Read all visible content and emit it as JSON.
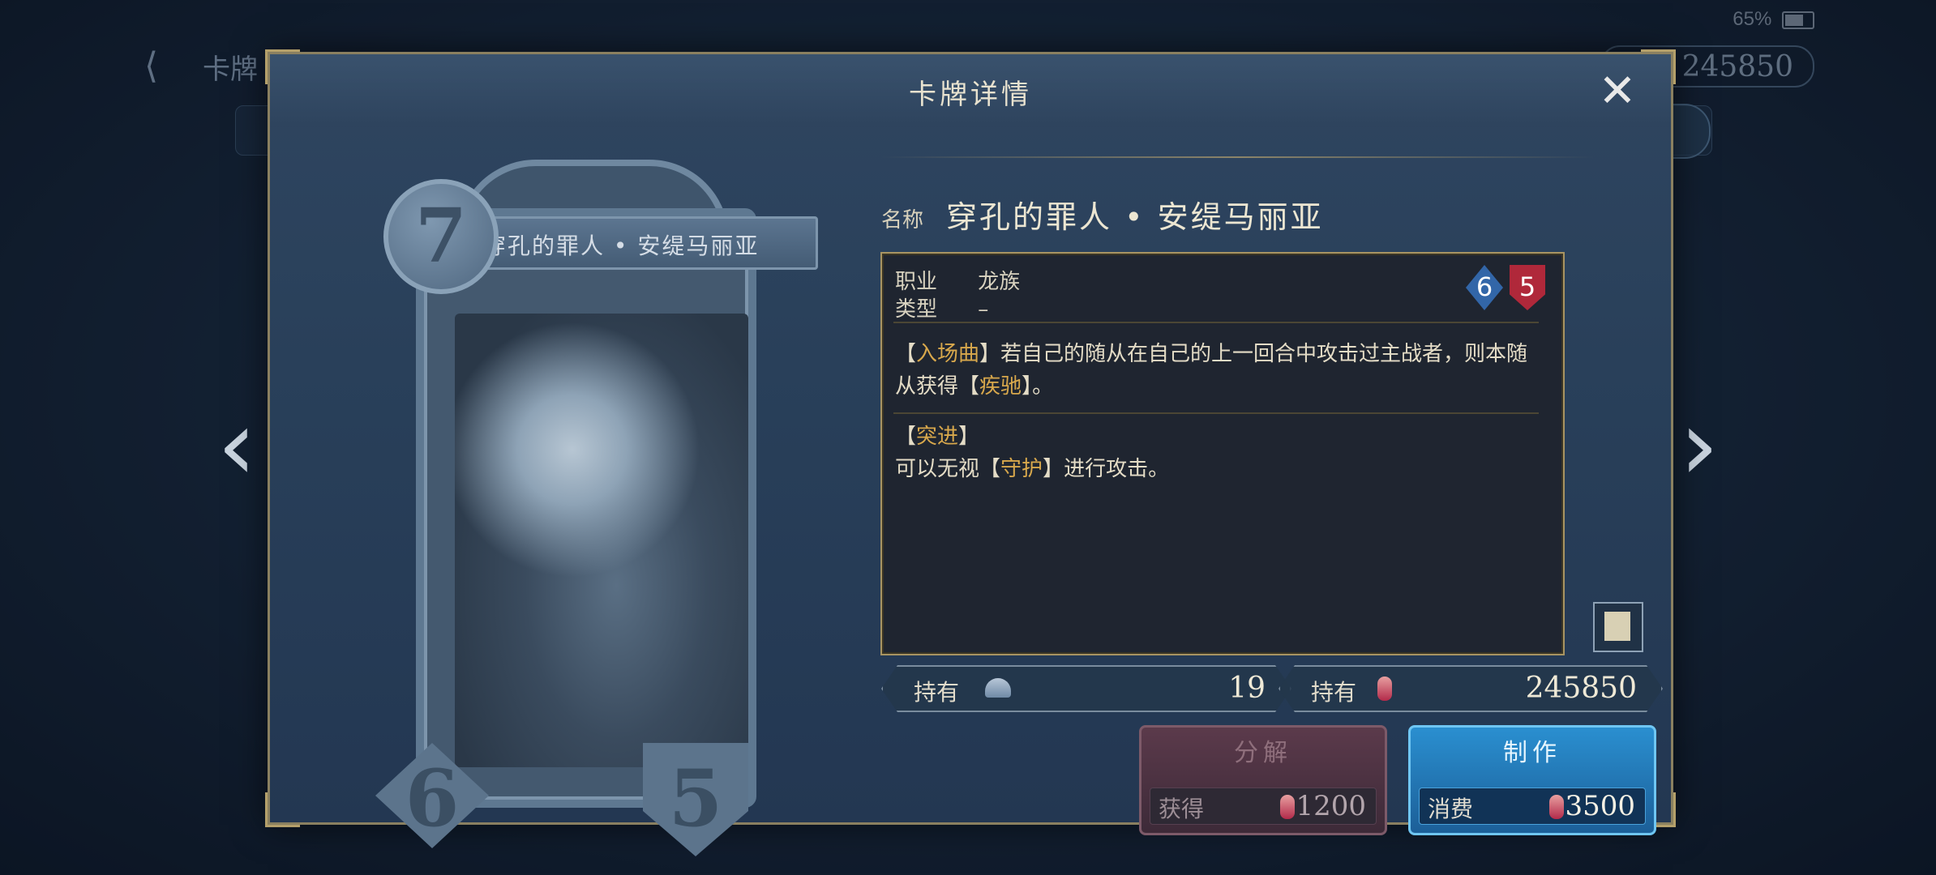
{
  "status_bar": {
    "battery": "65%"
  },
  "background": {
    "screen_title": "卡牌",
    "currency": "245850"
  },
  "modal": {
    "title": "卡牌详情",
    "close_icon": "close-icon"
  },
  "card": {
    "cost": "7",
    "name": "穿孔的罪人 • 安缇马丽亚",
    "attack": "6",
    "health": "5"
  },
  "details": {
    "name_label": "名称",
    "name_value": "穿孔的罪人 • 安缇马丽亚",
    "class_label": "职业",
    "class_value": "龙族",
    "type_label": "类型",
    "type_value": "–",
    "stat_attack": "6",
    "stat_health": "5",
    "ability1": {
      "open": "【",
      "keyword": "入场曲",
      "close": "】",
      "text1": "若自己的随从在自己的上一回合中攻击过主战者，则本随从获得",
      "open2": "【",
      "keyword2": "疾驰",
      "close2": "】",
      "text2": "。"
    },
    "ability2": {
      "open": "【",
      "keyword": "突进",
      "close": "】",
      "line2_pre": "可以无视",
      "open2": "【",
      "keyword2": "守护",
      "close2": "】",
      "line2_post": "进行攻击。"
    }
  },
  "holdings": {
    "cards_label": "持有",
    "cards_count": "19",
    "vials_label": "持有",
    "vials_count": "245850"
  },
  "actions": {
    "dismantle_title": "分解",
    "dismantle_sub_label": "获得",
    "dismantle_value": "1200",
    "craft_title": "制作",
    "craft_sub_label": "消费",
    "craft_value": "3500"
  },
  "colors": {
    "keyword": "#d8a84c",
    "attack_gem": "#3266a8",
    "health_gem": "#b0283a",
    "craft_button": "#2a8fd0"
  }
}
